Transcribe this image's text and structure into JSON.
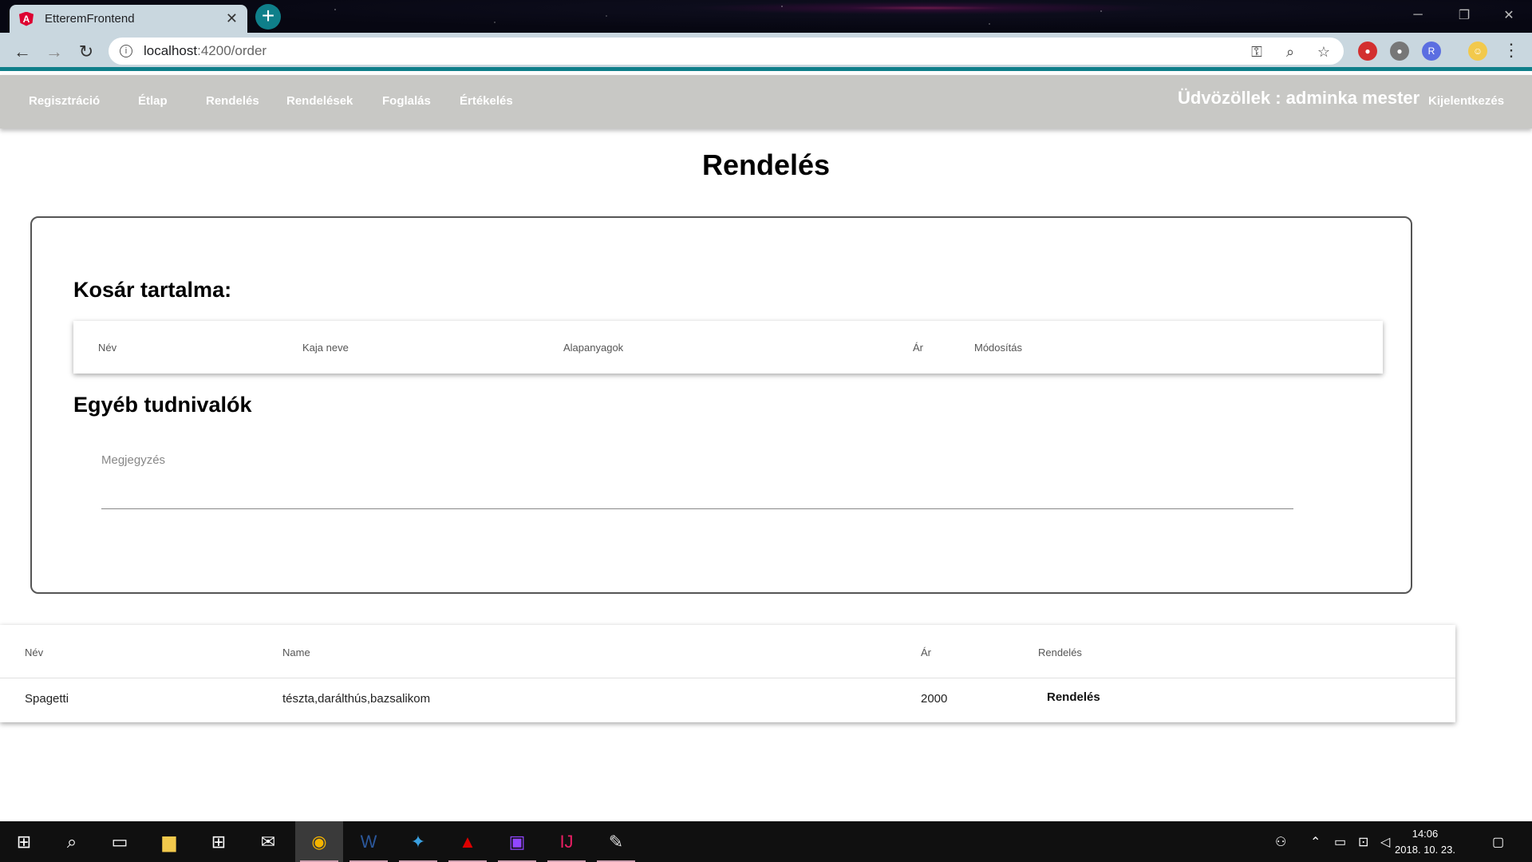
{
  "browser": {
    "tab_title": "EtteremFrontend",
    "tab_close": "✕",
    "new_tab": "+",
    "url_host": "localhost",
    "url_path": ":4200/order",
    "win_minimize": "─",
    "win_restore": "❐",
    "win_close": "✕"
  },
  "nav": {
    "links": [
      "Regisztráció",
      "Étlap",
      "Rendelés",
      "Rendelések",
      "Foglalás",
      "Értékelés"
    ],
    "welcome": "Üdvözöllek : adminka mester",
    "logout": "Kijelentkezés"
  },
  "page": {
    "title": "Rendelés",
    "cart_heading": "Kosár tartalma:",
    "cart_columns": [
      "Név",
      "Kaja neve",
      "Alapanyagok",
      "Ár",
      "Módosítás"
    ],
    "other_heading": "Egyéb tudnivalók",
    "note_placeholder": "Megjegyzés"
  },
  "menu_table": {
    "columns": [
      "Név",
      "Name",
      "Ár",
      "Rendelés"
    ],
    "rows": [
      {
        "name": "Spagetti",
        "ingredients": "tészta,darálthús,bazsalikom",
        "price": "2000",
        "action": "Rendelés"
      }
    ]
  },
  "taskbar": {
    "time": "14:06",
    "date": "2018. 10. 23."
  },
  "colors": {
    "navbar": "#c8c8c5",
    "chrome_toolbar": "#c9d7df",
    "accent_teal": "#0f7f8a"
  }
}
